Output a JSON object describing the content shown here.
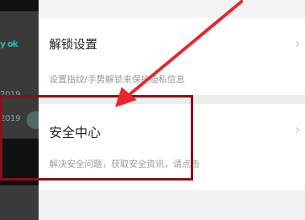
{
  "background_app": {
    "fragment_text": "y ok",
    "year_1": "2019",
    "year_2": "2019"
  },
  "settings": {
    "items": [
      {
        "title": "解锁设置",
        "subtitle": "设置指纹/手势解锁来保护隐私信息",
        "chevron_icon": "chevron-right-icon"
      },
      {
        "title": "安全中心",
        "subtitle": "解决安全问题，获取安全资讯，请点击",
        "chevron_icon": "chevron-right-icon"
      }
    ]
  },
  "annotation": {
    "color": "#8b0f14",
    "arrow_color": "#e8262c"
  }
}
